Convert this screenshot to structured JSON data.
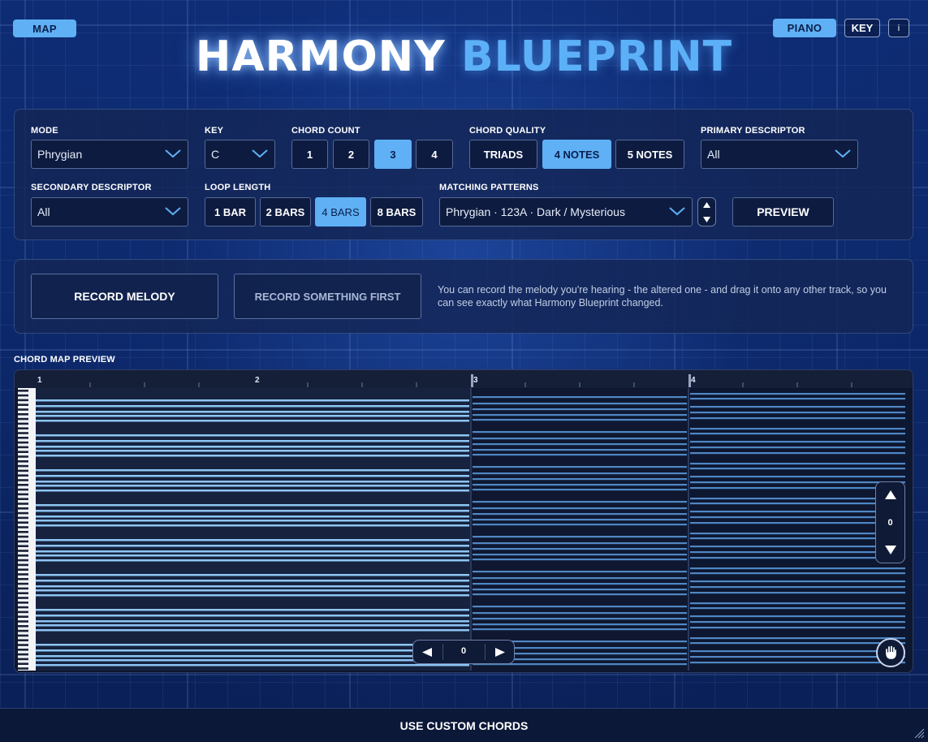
{
  "header": {
    "map_label": "MAP",
    "piano_label": "PIANO",
    "key_label": "KEY",
    "info_label": "i",
    "title_word1": "HARMONY",
    "title_word2": "BLUEPRINT"
  },
  "settings": {
    "mode": {
      "label": "MODE",
      "value": "Phrygian"
    },
    "key": {
      "label": "KEY",
      "value": "C"
    },
    "chord_count": {
      "label": "CHORD COUNT",
      "options": [
        "1",
        "2",
        "3",
        "4"
      ],
      "selected": "3"
    },
    "chord_quality": {
      "label": "CHORD QUALITY",
      "options": [
        "TRIADS",
        "4 NOTES",
        "5 NOTES"
      ],
      "selected": "4 NOTES"
    },
    "primary_descriptor": {
      "label": "PRIMARY DESCRIPTOR",
      "value": "All"
    },
    "secondary_descriptor": {
      "label": "SECONDARY DESCRIPTOR",
      "value": "All"
    },
    "loop_length": {
      "label": "LOOP LENGTH",
      "options": [
        "1 BAR",
        "2 BARS",
        "4 BARS",
        "8 BARS"
      ],
      "selected": "4 BARS"
    },
    "matching_patterns": {
      "label": "MATCHING PATTERNS",
      "value": "Phrygian · 123A · Dark / Mysterious"
    },
    "preview_label": "PREVIEW"
  },
  "record": {
    "record_melody_label": "RECORD MELODY",
    "record_first_label": "RECORD SOMETHING FIRST",
    "help_text": "You can record the melody you're hearing - the altered one - and drag it onto any other track, so you can see exactly what Harmony Blueprint changed."
  },
  "chord_map": {
    "label": "CHORD MAP PREVIEW",
    "bar_numbers": [
      "1",
      "2",
      "3",
      "4"
    ],
    "vertical_offset": "0",
    "horizontal_offset": "0"
  },
  "footer": {
    "use_custom_label": "USE CUSTOM CHORDS"
  },
  "colors": {
    "accent": "#5fb0f5",
    "background": "#0c2767",
    "note_bright": "#8ec5f3",
    "note_dim": "#4f87c4"
  }
}
